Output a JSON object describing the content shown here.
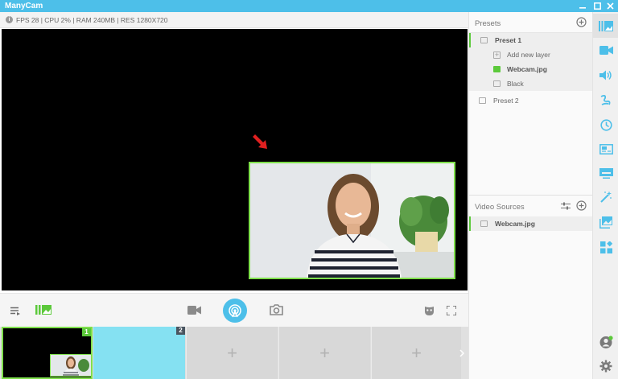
{
  "app": {
    "title": "ManyCam"
  },
  "window_controls": {
    "minimize": "–",
    "maximize": "□",
    "close": "✕"
  },
  "status": {
    "stats": "FPS 28 | CPU 2% | RAM 240MB | RES 1280X720"
  },
  "presets_panel": {
    "title": "Presets",
    "items": [
      {
        "label": "Preset 1",
        "active": true
      },
      {
        "label": "Add new layer"
      },
      {
        "label": "Webcam.jpg",
        "selected": true
      },
      {
        "label": "Black"
      },
      {
        "label": "Preset 2"
      }
    ]
  },
  "video_sources": {
    "title": "Video Sources",
    "items": [
      {
        "label": "Webcam.jpg"
      }
    ]
  },
  "preset_slots": [
    {
      "number": "1"
    },
    {
      "number": "2"
    },
    {
      "plus": "+"
    },
    {
      "plus": "+"
    },
    {
      "plus": "+"
    }
  ],
  "colors": {
    "accent": "#4dbfe9",
    "green": "#7fe04c",
    "cyan_slot": "#85e1f2"
  },
  "sidebar_icons": [
    "presets-icon",
    "camera-icon",
    "volume-icon",
    "draw-icon",
    "clock-icon",
    "picture-in-picture-icon",
    "lower-third-icon",
    "effects-wand-icon",
    "images-icon",
    "widgets-icon",
    "account-icon",
    "settings-icon"
  ]
}
